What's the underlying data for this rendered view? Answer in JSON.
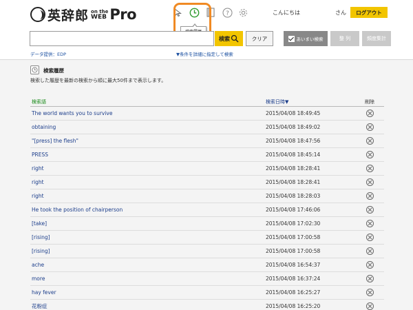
{
  "header": {
    "logo_main": "英辞郎",
    "logo_on": "on the",
    "logo_web": "WEB",
    "logo_pro": "Pro",
    "icons": [
      "cursor-icon",
      "history-icon",
      "book-icon",
      "help-icon",
      "gear-icon"
    ],
    "tooltip": "検索履歴",
    "greeting": "こんにちは",
    "greeting_suffix": "さん",
    "logout_label": "ログアウト"
  },
  "search": {
    "value": "",
    "placeholder": "",
    "search_label": "検索",
    "clear_label": "クリア",
    "fuzzy_label": "あいまい検索",
    "fuzzy_checked": true,
    "sort_label": "整 列",
    "freq_label": "頻度集計",
    "data_source": "データ提供：EDP",
    "advanced_link": "▼条件を詳細に指定して検索"
  },
  "panel": {
    "title": "検索履歴",
    "description": "検索した履歴を最新の検索から順に最大50件まで表示します。"
  },
  "table": {
    "headers": {
      "term": "検索語",
      "date": "検索日時▼",
      "delete": "削除"
    },
    "rows": [
      {
        "term": "The world wants you to survive",
        "date": "2015/04/08 18:49:45"
      },
      {
        "term": "obtaining",
        "date": "2015/04/08 18:49:02"
      },
      {
        "term": "\"[press] the flesh\"",
        "date": "2015/04/08 18:47:56"
      },
      {
        "term": "PRESS",
        "date": "2015/04/08 18:45:14"
      },
      {
        "term": "right",
        "date": "2015/04/08 18:28:41"
      },
      {
        "term": "right",
        "date": "2015/04/08 18:28:41"
      },
      {
        "term": "right",
        "date": "2015/04/08 18:28:03"
      },
      {
        "term": "He took the position of chairperson",
        "date": "2015/04/08 17:46:06"
      },
      {
        "term": "[take]",
        "date": "2015/04/08 17:02:30"
      },
      {
        "term": "[rising]",
        "date": "2015/04/08 17:00:58"
      },
      {
        "term": "[rising]",
        "date": "2015/04/08 17:00:58"
      },
      {
        "term": "ache",
        "date": "2015/04/08 16:54:37"
      },
      {
        "term": "more",
        "date": "2015/04/08 16:37:24"
      },
      {
        "term": "hay fever",
        "date": "2015/04/08 16:25:27"
      },
      {
        "term": "花粉症",
        "date": "2015/04/08 16:25:20"
      }
    ]
  },
  "colors": {
    "accent_yellow": "#f2c500",
    "highlight_orange": "#f08a24",
    "link_blue": "#1a3c8a",
    "header_green": "#1a8a1a"
  }
}
